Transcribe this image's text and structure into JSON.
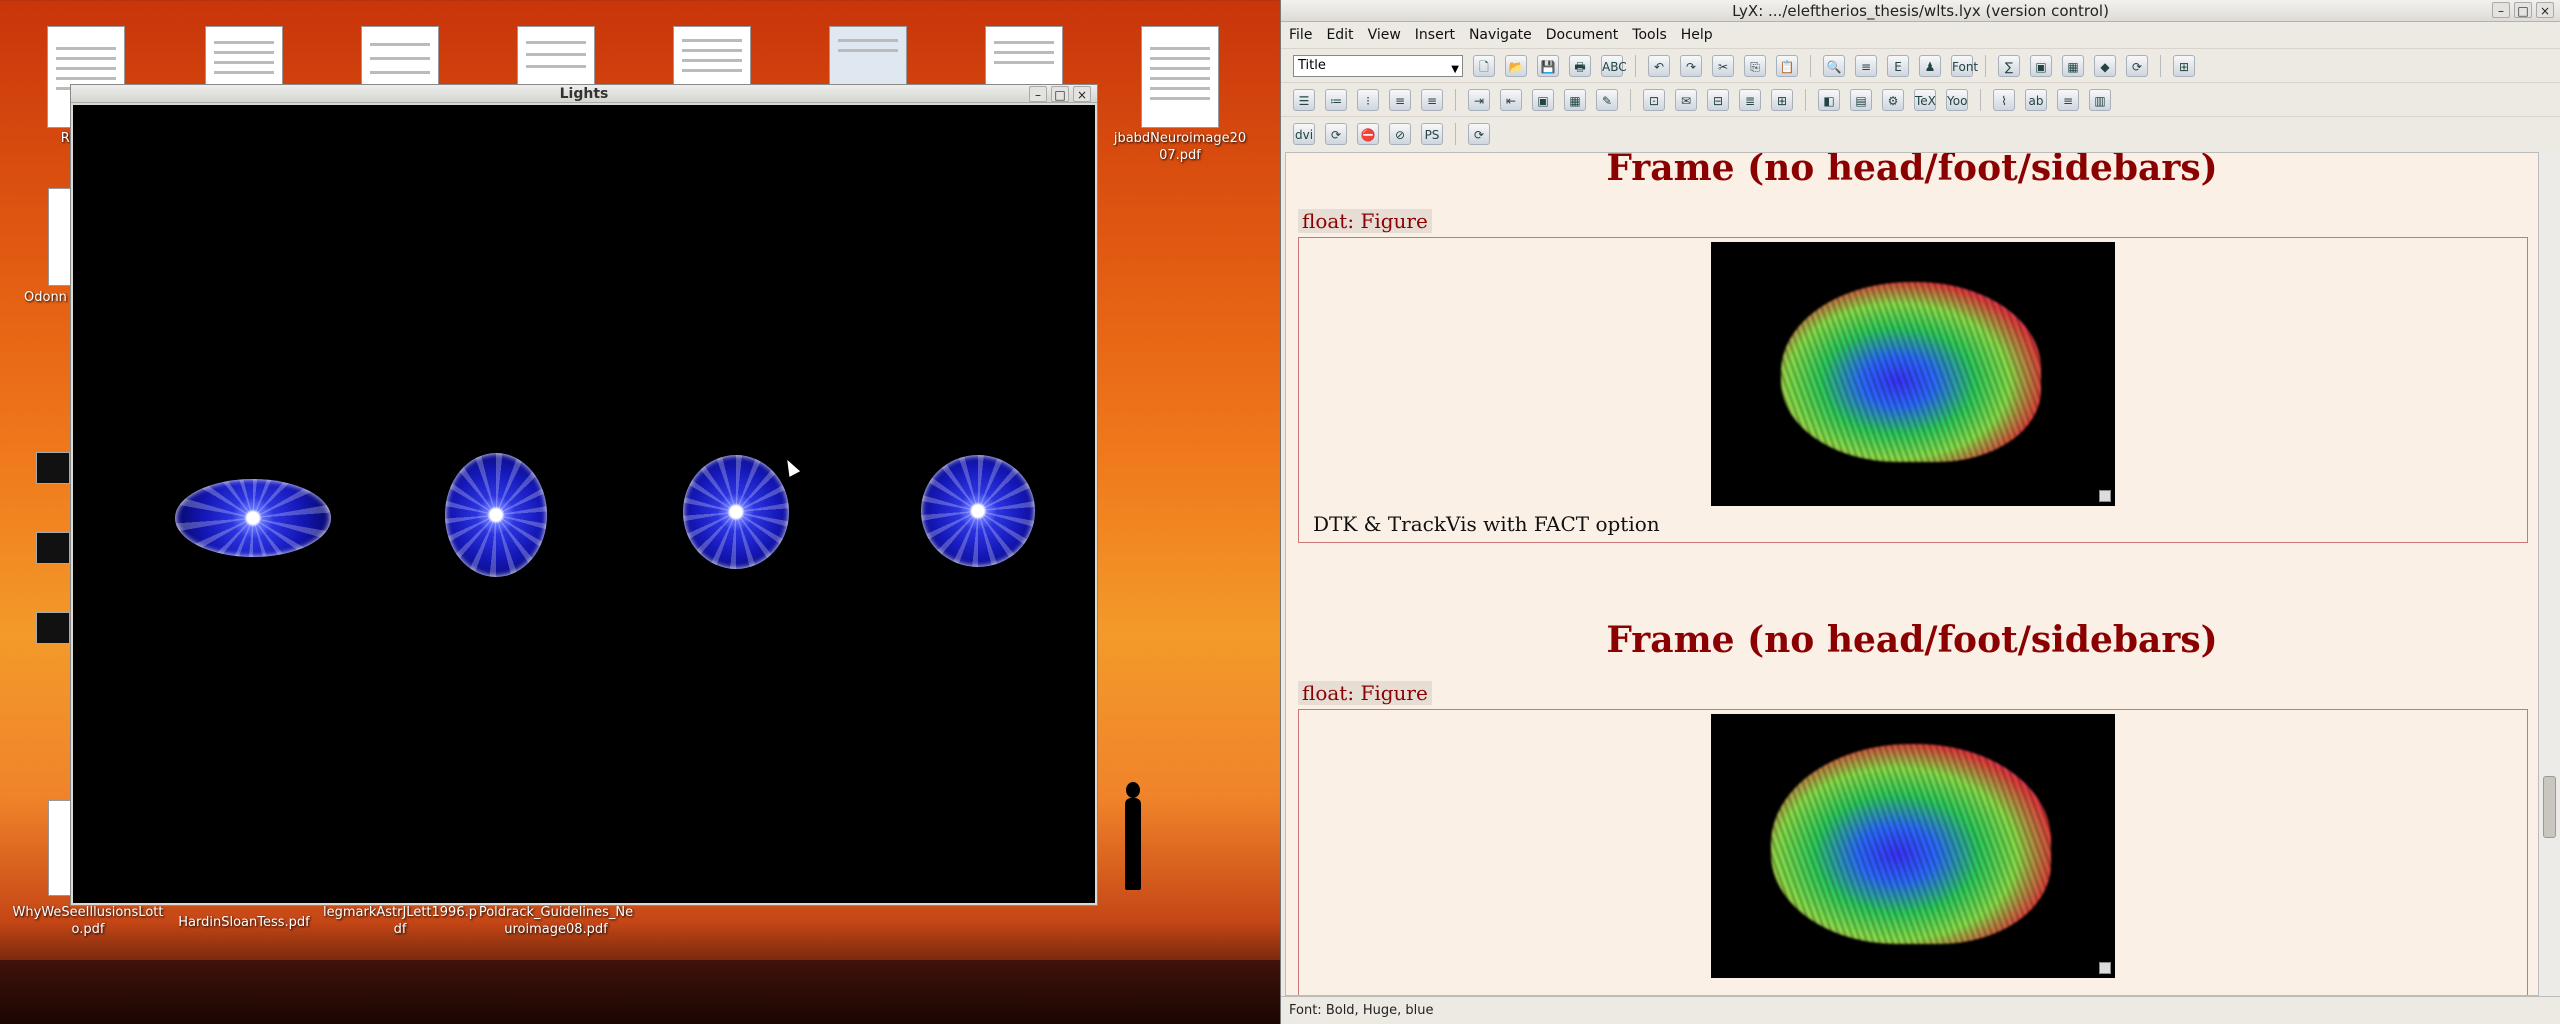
{
  "desktop": {
    "top_icons": [
      {
        "label": "ReeseM",
        "x": 0
      },
      {
        "label": "",
        "x": 1
      },
      {
        "label": "",
        "x": 2
      },
      {
        "label": "",
        "x": 3
      },
      {
        "label": "",
        "x": 4
      },
      {
        "label": "",
        "x": 5
      },
      {
        "label": "",
        "x": 6
      },
      {
        "label": "jbabdNeuroimage2007.pdf",
        "x": 7
      }
    ],
    "side_labels": [
      "Odonn"
    ],
    "bottom_icons": [
      {
        "label": "WhyWeSeeIllusionsLotto.pdf"
      },
      {
        "label": "HardinSloanTess.pdf"
      },
      {
        "label": "legmarkAstrJLett1996.pdf"
      },
      {
        "label": "Poldrack_Guidelines_Neuroimage08.pdf"
      }
    ]
  },
  "lights_window": {
    "title": "Lights",
    "controls": {
      "minimize": "–",
      "maximize": "□",
      "close": "×"
    }
  },
  "lyx_window": {
    "title": "LyX: .../eleftherios_thesis/wlts.lyx (version control)",
    "menu": [
      "File",
      "Edit",
      "View",
      "Insert",
      "Navigate",
      "Document",
      "Tools",
      "Help"
    ],
    "layout_select": "Title",
    "toolbar1_icons": [
      "new-document-icon",
      "open-icon",
      "save-icon",
      "print-icon",
      "spellcheck-icon",
      "undo-icon",
      "redo-icon",
      "cut-icon",
      "copy-icon",
      "paste-icon",
      "find-icon",
      "toc-icon",
      "emphasis-icon",
      "noun-icon",
      "font-icon",
      "math-icon",
      "graphics-icon",
      "table-icon",
      "view-icon",
      "update-icon",
      "wrap-icon"
    ],
    "toolbar1_glyphs": [
      "🗋",
      "📂",
      "💾",
      "🖶",
      "ABC",
      "↶",
      "↷",
      "✂",
      "⎘",
      "📋",
      "🔍",
      "≡",
      "E",
      "♟",
      "Font",
      "∑",
      "▣",
      "▦",
      "◆",
      "⟳",
      "⊞"
    ],
    "toolbar2_glyphs": [
      "☰",
      "≔",
      "⁝",
      "≡",
      "≡",
      "⇥",
      "⇤",
      "▣",
      "▦",
      "✎",
      "⊡",
      "✉",
      "⊟",
      "≣",
      "⊞",
      "◧",
      "▤",
      "⚙",
      "TeX",
      "Yoo",
      "⌇",
      "ab",
      "≡",
      "▥"
    ],
    "toolbar3_glyphs": [
      "dvi",
      "⟳",
      "⛔",
      "⊘",
      "PS",
      "⟳"
    ],
    "document": {
      "sections": [
        {
          "frame_title": "Frame (no head/foot/sidebars)",
          "float_label": "float: Figure",
          "caption": "DTK & TrackVis with FACT option"
        },
        {
          "frame_title": "Frame (no head/foot/sidebars)",
          "float_label": "float: Figure",
          "caption": ""
        }
      ]
    },
    "status_text": "Font: Bold, Huge, blue"
  }
}
